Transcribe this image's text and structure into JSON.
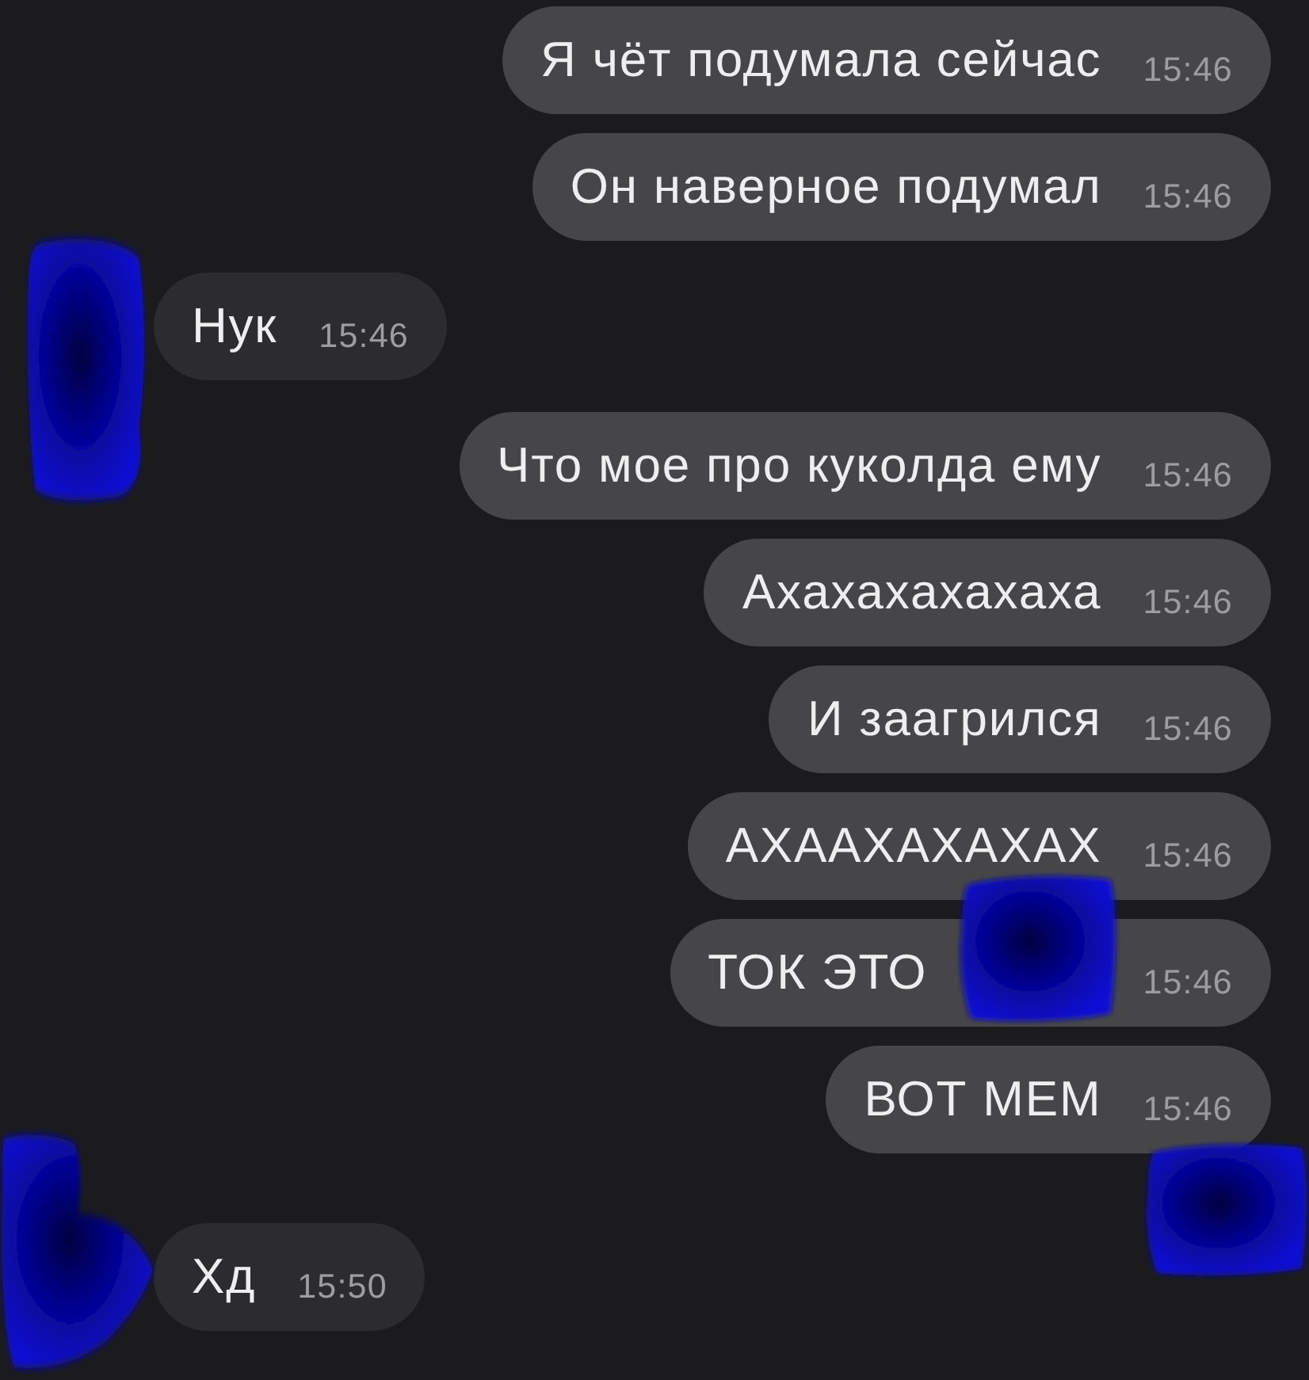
{
  "messages": [
    {
      "kind": "outgoing",
      "text": "Я чёт подумала сейчас",
      "time": "15:46"
    },
    {
      "kind": "outgoing",
      "text": "Он наверное подумал",
      "time": "15:46"
    },
    {
      "kind": "incoming",
      "text": "Нук",
      "time": "15:46",
      "scribbles": [
        {
          "kind": "avatar"
        }
      ]
    },
    {
      "kind": "outgoing",
      "text": "Что мое про куколда ему",
      "time": "15:46"
    },
    {
      "kind": "outgoing",
      "text": "Ахахахахахаха",
      "time": "15:46"
    },
    {
      "kind": "outgoing",
      "text": "И заагрился",
      "time": "15:46"
    },
    {
      "kind": "outgoing",
      "text": "АХААХАХАХАХ",
      "time": "15:46"
    },
    {
      "kind": "outgoing",
      "text": "ТОК ЭТО",
      "time": "15:46",
      "scribbles": [
        {
          "kind": "inline"
        }
      ]
    },
    {
      "kind": "outgoing",
      "text": "ВОТ МЕМ",
      "time": "15:46",
      "scribbles": [
        {
          "kind": "corner"
        }
      ]
    },
    {
      "kind": "incoming",
      "text": "Хд",
      "time": "15:50",
      "scribbles": [
        {
          "kind": "wide"
        }
      ]
    }
  ]
}
